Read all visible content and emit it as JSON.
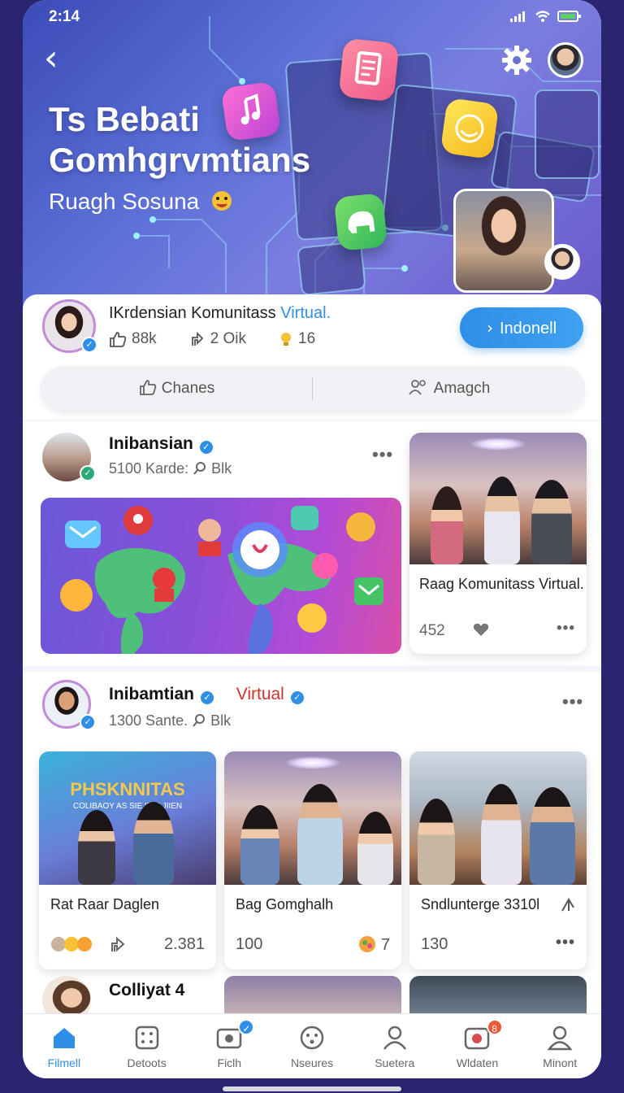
{
  "status": {
    "time": "2:14"
  },
  "hero": {
    "title_line1": "Ts Bebati",
    "title_line2": "Gomhgrvmtians",
    "subtitle": "Ruagh Sosuna"
  },
  "profile": {
    "name_prefix": "IKrdensian Komunitass",
    "name_accent": "Virtual.",
    "likes": "88k",
    "members": "2 Oik",
    "reactions": "16",
    "join_label": "Indonell",
    "tab_left": "Chanes",
    "tab_right": "Amagch"
  },
  "post1": {
    "author": "Inibansian",
    "meta": "5100 Karde:",
    "meta_suffix": "Blk",
    "side_title": "Raag Komunitass Virtual.",
    "side_count": "452"
  },
  "post2": {
    "author": "Inibamtian",
    "tag": "Virtual",
    "meta": "1300 Sante.",
    "meta_suffix": "Blk",
    "cards": [
      {
        "title": "Rat Raar Daglen",
        "stat": "2.381",
        "banner": "PHSKNNITAS",
        "banner_sub": "COLIBAOY AS SIE ITULJIIEN"
      },
      {
        "title": "Bag Gomghalh",
        "stat": "100",
        "stat2": "7"
      },
      {
        "title": "Sndlunterge 3310l",
        "stat": "130"
      }
    ]
  },
  "post3": {
    "author": "Colliyat 4"
  },
  "nav": [
    {
      "label": "Filmell",
      "icon": "home-icon"
    },
    {
      "label": "Detoots",
      "icon": "dice-icon"
    },
    {
      "label": "Ficlh",
      "icon": "camera-icon",
      "badge": "✓"
    },
    {
      "label": "Nseures",
      "icon": "face-icon"
    },
    {
      "label": "Suetera",
      "icon": "user-icon"
    },
    {
      "label": "Wldaten",
      "icon": "inbox-icon",
      "badge": "8"
    },
    {
      "label": "Minont",
      "icon": "profile-icon"
    }
  ],
  "colors": {
    "accent": "#2f8ee6",
    "tag_red": "#d0322b",
    "badge": "#ee5634"
  }
}
